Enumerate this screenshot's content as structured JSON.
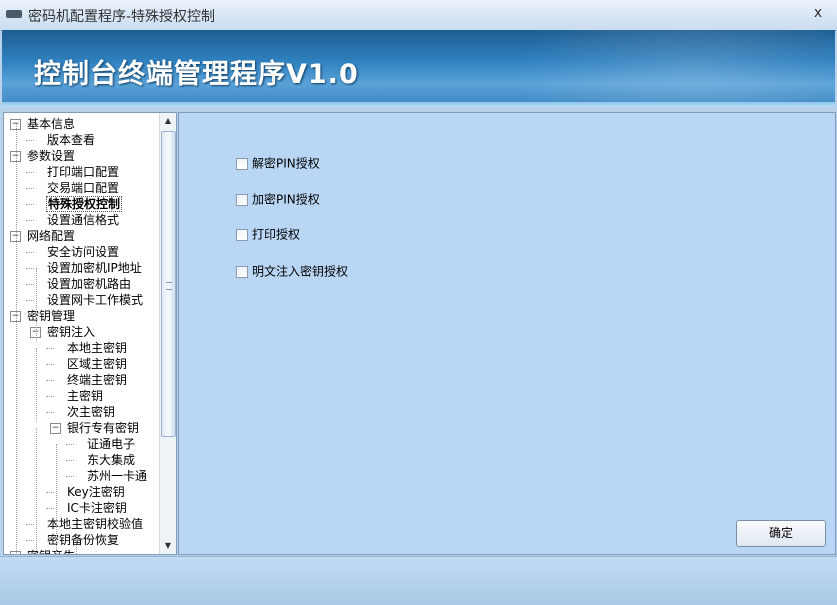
{
  "window": {
    "title": "密码机配置程序-特殊授权控制",
    "close_glyph": "x"
  },
  "banner": {
    "title": "控制台终端管理程序V1.0"
  },
  "tree": [
    {
      "label": "基本信息",
      "expander": "−"
    },
    {
      "label": "版本查看"
    },
    {
      "label": "参数设置",
      "expander": "−"
    },
    {
      "label": "打印端口配置"
    },
    {
      "label": "交易端口配置"
    },
    {
      "label": "特殊授权控制",
      "selected": true
    },
    {
      "label": "设置通信格式"
    },
    {
      "label": "网络配置",
      "expander": "−"
    },
    {
      "label": "安全访问设置"
    },
    {
      "label": "设置加密机IP地址"
    },
    {
      "label": "设置加密机路由"
    },
    {
      "label": "设置网卡工作模式"
    },
    {
      "label": "密钥管理",
      "expander": "−"
    },
    {
      "label": "密钥注入",
      "expander": "−"
    },
    {
      "label": "本地主密钥"
    },
    {
      "label": "区域主密钥"
    },
    {
      "label": "终端主密钥"
    },
    {
      "label": "主密钥"
    },
    {
      "label": "次主密钥"
    },
    {
      "label": "银行专有密钥",
      "expander": "−"
    },
    {
      "label": "证通电子"
    },
    {
      "label": "东大集成"
    },
    {
      "label": "苏州一卡通"
    },
    {
      "label": "Key注密钥"
    },
    {
      "label": "IC卡注密钥"
    },
    {
      "label": "本地主密钥校验值"
    },
    {
      "label": "密钥备份恢复"
    },
    {
      "label": "密钥产生",
      "expander": "−"
    }
  ],
  "options": [
    {
      "label": "解密PIN授权",
      "checked": false
    },
    {
      "label": "加密PIN授权",
      "checked": false
    },
    {
      "label": "打印授权",
      "checked": false
    },
    {
      "label": "明文注入密钥授权",
      "checked": false
    }
  ],
  "buttons": {
    "ok": "确定"
  },
  "colors": {
    "banner": "#2f80bf",
    "content_bg": "#b9d7f5"
  }
}
